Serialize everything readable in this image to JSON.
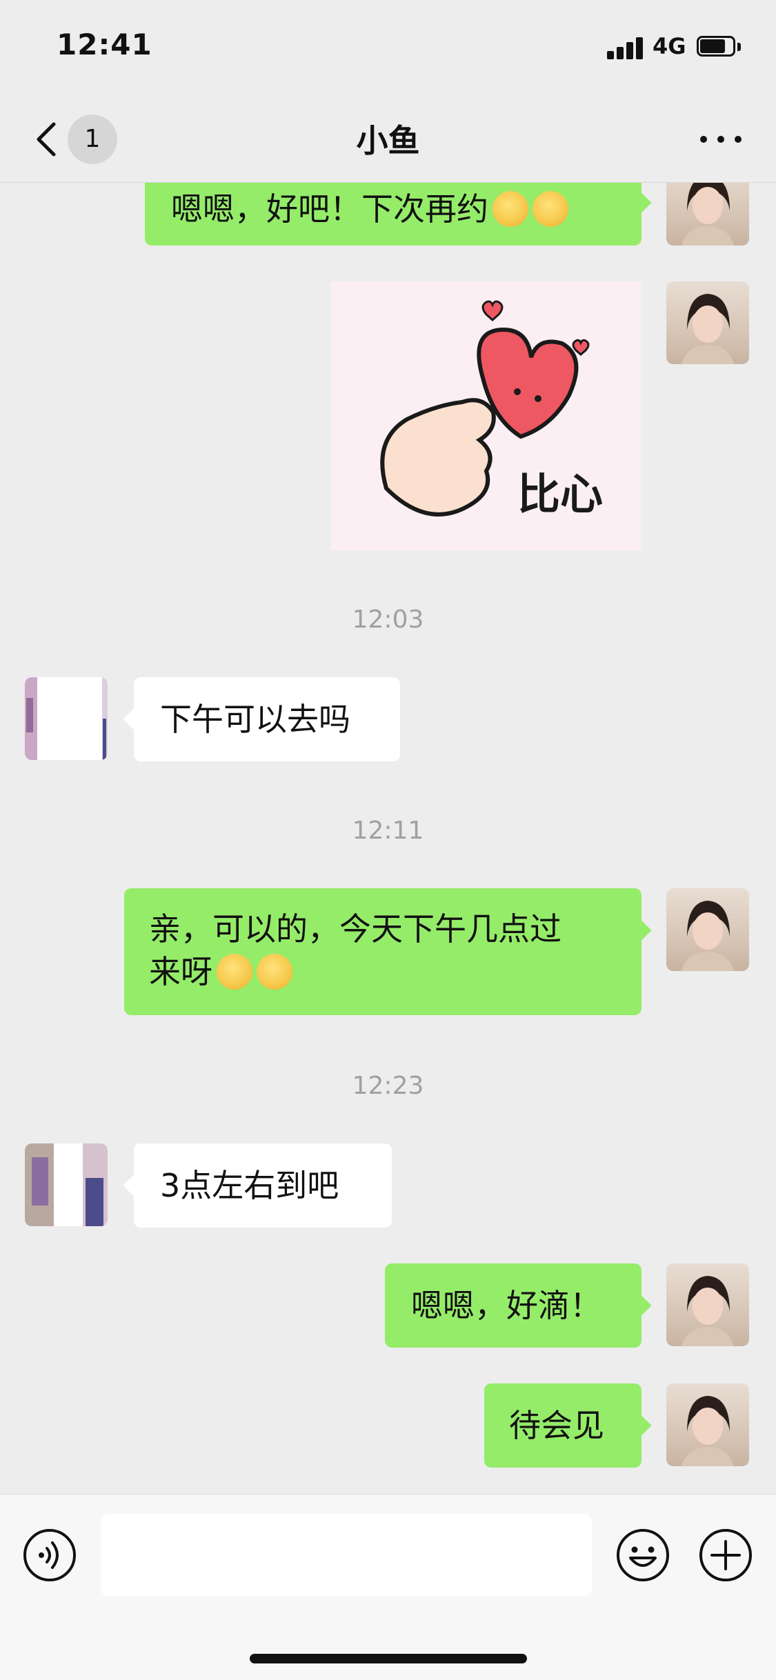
{
  "status_bar": {
    "time": "12:41",
    "network": "4G"
  },
  "nav": {
    "unread_count": "1",
    "title": "小鱼"
  },
  "messages": [
    {
      "type": "text",
      "side": "out",
      "text": "嗯嗯，好吧！下次再约",
      "emoji": "smile-emoji"
    },
    {
      "type": "sticker",
      "side": "out",
      "caption": "比心"
    },
    {
      "type": "timestamp",
      "text": "12:03"
    },
    {
      "type": "text",
      "side": "in",
      "text": "下午可以去吗"
    },
    {
      "type": "timestamp",
      "text": "12:11"
    },
    {
      "type": "text",
      "side": "out",
      "line1": "亲，可以的，今天下午几点过",
      "line2": "来呀",
      "emoji": "grin-emoji"
    },
    {
      "type": "timestamp",
      "text": "12:23"
    },
    {
      "type": "text",
      "side": "in",
      "text": "3点左右到吧"
    },
    {
      "type": "text",
      "side": "out",
      "text": "嗯嗯，好滴！"
    },
    {
      "type": "text",
      "side": "out",
      "text": "待会见"
    }
  ],
  "input_bar": {
    "placeholder": "",
    "icons": [
      "voice-icon",
      "emoji-icon",
      "plus-icon"
    ]
  },
  "colors": {
    "outgoing_bubble": "#95ec69",
    "incoming_bubble": "#ffffff",
    "background": "#ededed"
  }
}
